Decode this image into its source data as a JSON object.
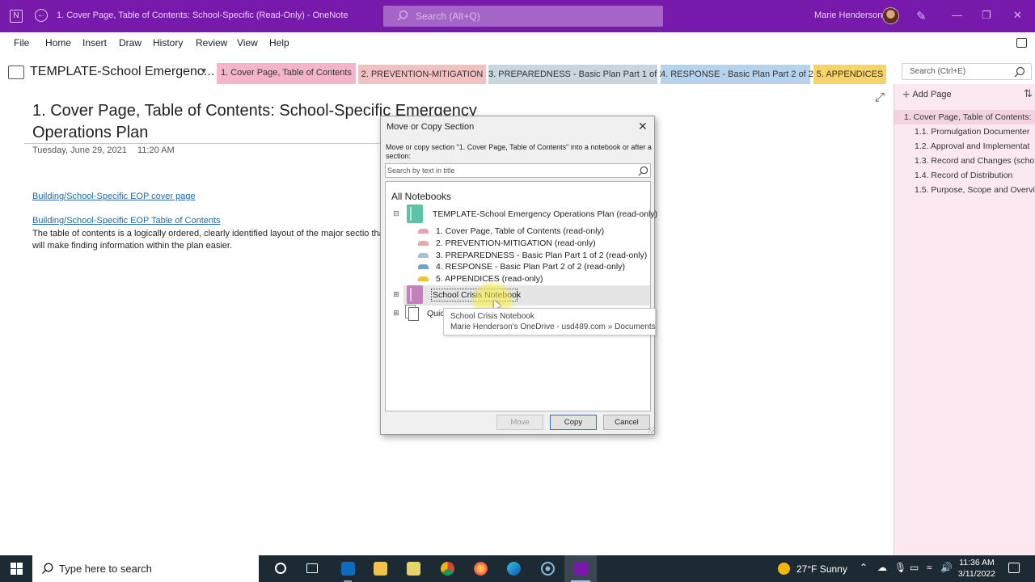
{
  "window": {
    "title": "1. Cover Page, Table of Contents: School-Specific  (Read-Only)  -  OneNote",
    "search_placeholder": "Search (Alt+Q)",
    "user_name": "Marie Henderson",
    "accent": "#7719aa"
  },
  "menu": [
    "File",
    "Home",
    "Insert",
    "Draw",
    "History",
    "Review",
    "View",
    "Help"
  ],
  "notebook": {
    "name": "TEMPLATE-School Emergenc...",
    "sections": [
      {
        "label": "1. Cover Page, Table of Contents",
        "color": "#f4b4c9"
      },
      {
        "label": "2. PREVENTION-MITIGATION",
        "color": "#f2c2c2"
      },
      {
        "label": "3. PREPAREDNESS - Basic Plan Part 1 of 2",
        "color": "#c9d6df"
      },
      {
        "label": "4. RESPONSE - Basic Plan Part 2 of 2",
        "color": "#b6d3ee"
      },
      {
        "label": "5. APPENDICES",
        "color": "#f7d46a"
      }
    ],
    "page_search_placeholder": "Search (Ctrl+E)"
  },
  "page": {
    "title": "1. Cover Page, Table of Contents: School-Specific Emergency Operations Plan",
    "date": "Tuesday, June 29, 2021",
    "time": "11:20 AM",
    "link1": "Building/School-Specific EOP cover page",
    "link2": "Building/School-Specific EOP Table of Contents",
    "body": "The table of contents is a logically ordered, clearly identified layout of the major sectio that will make finding information within the plan easier."
  },
  "pagelist": {
    "add_label": "Add Page",
    "pages": [
      {
        "label": "1. Cover Page, Table of Contents:",
        "selected": true,
        "indent": false
      },
      {
        "label": "1.1. Promulgation Documenter",
        "selected": false,
        "indent": true
      },
      {
        "label": "1.2. Approval and Implementat",
        "selected": false,
        "indent": true
      },
      {
        "label": "1.3. Record and Changes (scho",
        "selected": false,
        "indent": true
      },
      {
        "label": "1.4. Record of Distribution",
        "selected": false,
        "indent": true
      },
      {
        "label": "1.5. Purpose, Scope and Overvi",
        "selected": false,
        "indent": true
      }
    ]
  },
  "dialog": {
    "title": "Move or Copy Section",
    "instruction": "Move or copy section \"1. Cover Page, Table of Contents\" into a notebook or after a section:",
    "search_placeholder": "Search by text in title",
    "all_notebooks": "All Notebooks",
    "notebooks": [
      {
        "name": "TEMPLATE-School Emergency Operations Plan (read-only)",
        "color": "#5cc3a8",
        "expanded": true,
        "sections": [
          {
            "label": "1. Cover Page, Table of Contents (read-only)",
            "color": "#e9a0b8"
          },
          {
            "label": "2. PREVENTION-MITIGATION (read-only)",
            "color": "#e8a9a9"
          },
          {
            "label": "3. PREPAREDNESS - Basic Plan Part 1 of 2 (read-only)",
            "color": "#aebfcc"
          },
          {
            "label": "4. RESPONSE - Basic Plan Part 2 of 2 (read-only)",
            "color": "#6da3cf"
          },
          {
            "label": "5. APPENDICES (read-only)",
            "color": "#f2c230"
          }
        ]
      },
      {
        "name": "School Crisis Notebook",
        "color": "#c47fbf",
        "expanded": false
      },
      {
        "name": "Quic",
        "expanded": false
      }
    ],
    "tooltip_name": "School Crisis Notebook",
    "tooltip_path": "Marie Henderson's OneDrive - usd489.com » Documents",
    "buttons": {
      "move": "Move",
      "copy": "Copy",
      "cancel": "Cancel"
    }
  },
  "taskbar": {
    "search_placeholder": "Type here to search",
    "weather": "27°F  Sunny",
    "time": "11:36 AM",
    "date": "3/11/2022"
  }
}
